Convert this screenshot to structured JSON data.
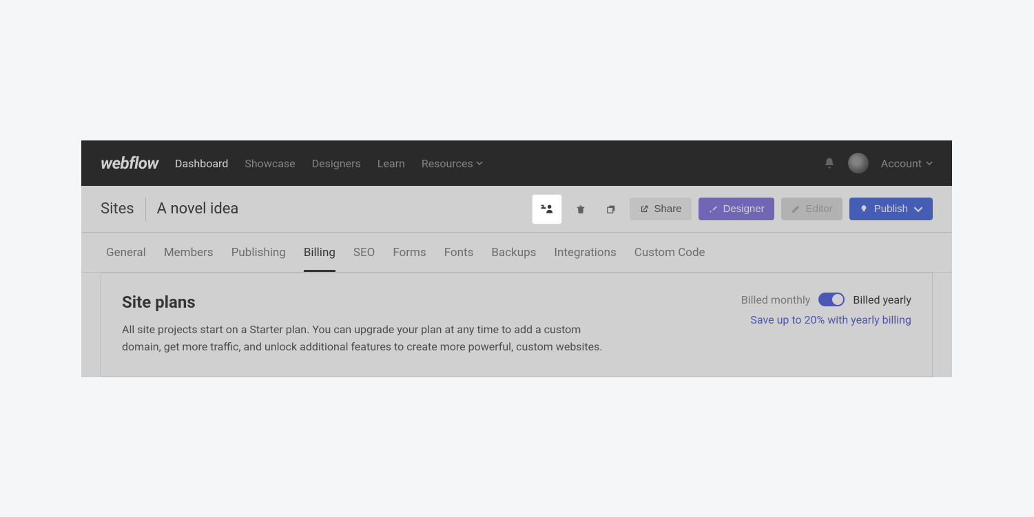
{
  "logo": "webflow",
  "nav": {
    "dashboard": "Dashboard",
    "showcase": "Showcase",
    "designers": "Designers",
    "learn": "Learn",
    "resources": "Resources"
  },
  "account_label": "Account",
  "breadcrumb": {
    "root": "Sites",
    "title": "A novel idea"
  },
  "actions": {
    "share": "Share",
    "designer": "Designer",
    "editor": "Editor",
    "publish": "Publish"
  },
  "tabs": {
    "general": "General",
    "members": "Members",
    "publishing": "Publishing",
    "billing": "Billing",
    "seo": "SEO",
    "forms": "Forms",
    "fonts": "Fonts",
    "backups": "Backups",
    "integrations": "Integrations",
    "custom_code": "Custom Code"
  },
  "panel": {
    "title": "Site plans",
    "description": "All site projects start on a Starter plan. You can upgrade your plan at any time to add a custom domain, get more traffic, and unlock additional features to create more powerful, custom websites.",
    "billed_monthly": "Billed monthly",
    "billed_yearly": "Billed yearly",
    "save_note": "Save up to 20% with yearly billing"
  }
}
